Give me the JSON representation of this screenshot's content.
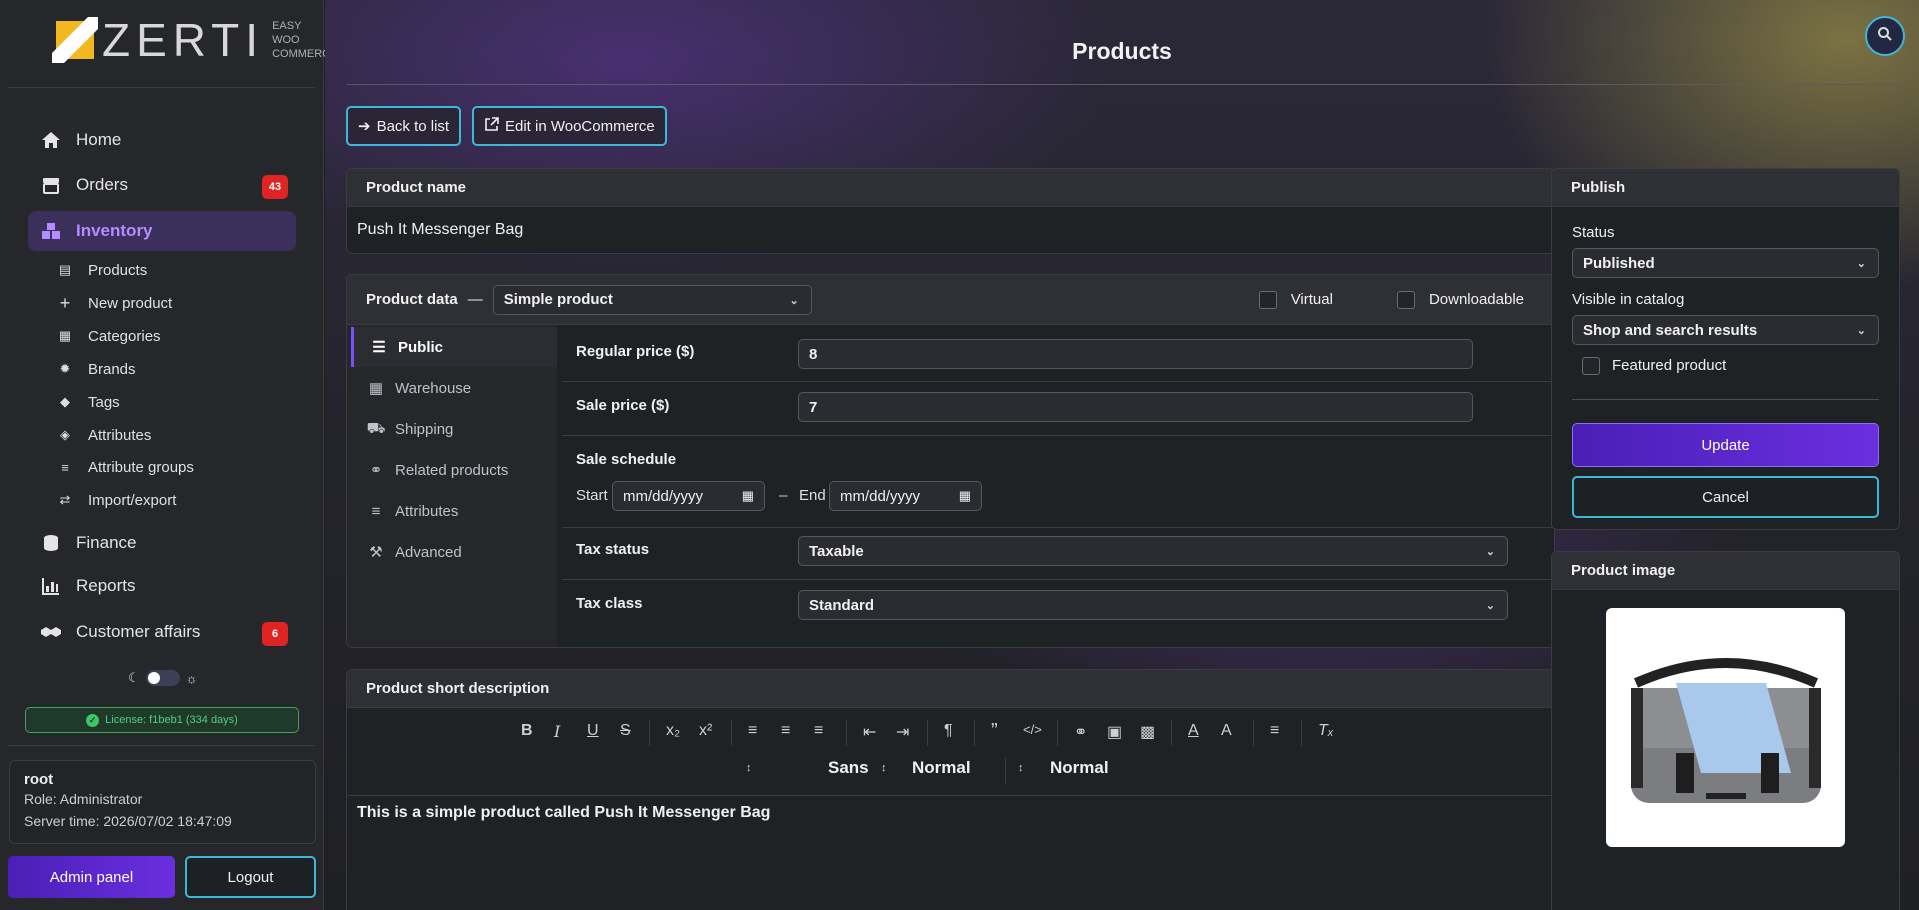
{
  "brand": {
    "name": "ZERTI",
    "tagline": [
      "EASY",
      "WOO",
      "COMMERCE"
    ]
  },
  "sidebar": {
    "items": [
      {
        "label": "Home",
        "icon": "home-icon"
      },
      {
        "label": "Orders",
        "icon": "store-icon",
        "badge": "43"
      },
      {
        "label": "Inventory",
        "icon": "boxes-icon",
        "active": true
      },
      {
        "label": "Finance",
        "icon": "coins-icon"
      },
      {
        "label": "Reports",
        "icon": "chart-icon"
      },
      {
        "label": "Customer affairs",
        "icon": "handshake-icon",
        "badge": "6"
      }
    ],
    "subitems": [
      {
        "label": "Products",
        "icon": "warehouse-icon"
      },
      {
        "label": "New product",
        "icon": "plus-icon"
      },
      {
        "label": "Categories",
        "icon": "categories-icon"
      },
      {
        "label": "Brands",
        "icon": "cog-icon"
      },
      {
        "label": "Tags",
        "icon": "tag-icon"
      },
      {
        "label": "Attributes",
        "icon": "tags-icon"
      },
      {
        "label": "Attribute groups",
        "icon": "layers-icon"
      },
      {
        "label": "Import/export",
        "icon": "arrows-icon"
      }
    ],
    "license": "License: f1beb1 (334 days)",
    "user": {
      "name": "root",
      "role": "Role: Administrator",
      "server_time": "Server time: 2026/07/02  18:47:09"
    },
    "admin_panel_label": "Admin panel",
    "logout_label": "Logout"
  },
  "header": {
    "title": "Products"
  },
  "actions": {
    "back_label": "Back to list",
    "edit_wc_label": "Edit in WooCommerce"
  },
  "product_name": {
    "label": "Product name",
    "value": "Push It Messenger Bag"
  },
  "product_data": {
    "label": "Product data",
    "dash": "—",
    "type": "Simple product",
    "virtual_label": "Virtual",
    "downloadable_label": "Downloadable",
    "tabs": [
      {
        "label": "Public",
        "active": true
      },
      {
        "label": "Warehouse"
      },
      {
        "label": "Shipping"
      },
      {
        "label": "Related products"
      },
      {
        "label": "Attributes"
      },
      {
        "label": "Advanced"
      }
    ],
    "regular_price_label": "Regular price ($)",
    "regular_price": "8",
    "sale_price_label": "Sale price ($)",
    "sale_price": "7",
    "sale_schedule_label": "Sale schedule",
    "start_label": "Start",
    "start_value": "mm/dd/yyyy",
    "range_dash": "–",
    "end_label": "End",
    "end_value": "mm/dd/yyyy",
    "tax_status_label": "Tax status",
    "tax_status": "Taxable",
    "tax_class_label": "Tax class",
    "tax_class": "Standard"
  },
  "short_description": {
    "label": "Product short description",
    "font": "Sans",
    "size": "Normal",
    "heading": "Normal",
    "text": "This is a simple product called Push It Messenger Bag"
  },
  "publish": {
    "title": "Publish",
    "status_label": "Status",
    "status": "Published",
    "visibility_label": "Visible in catalog",
    "visibility": "Shop and search results",
    "featured_label": "Featured product",
    "update_label": "Update",
    "cancel_label": "Cancel"
  },
  "product_image": {
    "title": "Product image"
  }
}
